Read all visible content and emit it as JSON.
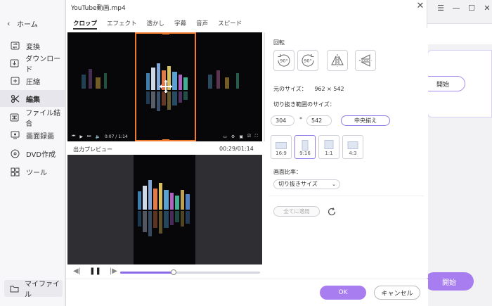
{
  "sidebar": {
    "home_label": "ホーム",
    "items": [
      {
        "label": "変換",
        "icon": "convert-icon"
      },
      {
        "label": "ダウンロード",
        "icon": "download-icon"
      },
      {
        "label": "圧縮",
        "icon": "compress-icon"
      },
      {
        "label": "編集",
        "icon": "scissors-icon"
      },
      {
        "label": "ファイル結合",
        "icon": "merge-icon"
      },
      {
        "label": "画面録画",
        "icon": "screen-record-icon"
      },
      {
        "label": "DVD作成",
        "icon": "dvd-icon"
      },
      {
        "label": "ツール",
        "icon": "tools-icon"
      }
    ],
    "my_files_label": "マイファイル"
  },
  "background": {
    "start_button_small": "開始",
    "start_button_large": "開始"
  },
  "dialog": {
    "title": "YouTube動画.mp4",
    "tabs": [
      "クロップ",
      "エフェクト",
      "透かし",
      "字幕",
      "音声",
      "スピード"
    ],
    "active_tab": "クロップ",
    "preview_label": "出力プレビュー",
    "preview_time": "00:29/01:14",
    "player_time_small": "0:07 / 1:14",
    "playback_progress": 0.38,
    "rotation_label": "回転",
    "rotate_buttons": [
      "rotate-left-90-icon",
      "rotate-right-90-icon",
      "flip-horizontal-icon",
      "flip-vertical-icon"
    ],
    "rotate_left_text": "90°",
    "rotate_right_text": "90°",
    "original_size_label": "元のサイズ：",
    "original_size_value": "962 × 542",
    "crop_size_label": "切り抜き範囲のサイズ：",
    "crop_width": "304",
    "crop_height": "542",
    "times_sign": "*",
    "center_button": "中央揃え",
    "ratios": [
      "16:9",
      "9:16",
      "1:1",
      "4:3"
    ],
    "active_ratio": "9:16",
    "aspect_label": "画面比率：",
    "aspect_select": "切り抜きサイズ",
    "apply_all": "全てに適用",
    "ok": "OK",
    "cancel": "キャンセル"
  },
  "colors": {
    "accent": "#a77df0",
    "crop_border": "#f07a2e",
    "progress": "#8b6be8"
  }
}
